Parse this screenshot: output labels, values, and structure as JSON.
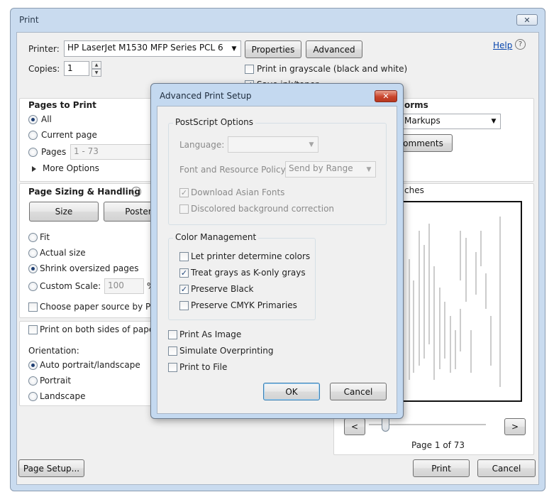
{
  "window": {
    "title": "Print",
    "close_glyph": "✕"
  },
  "printer": {
    "label": "Printer:",
    "selected": "HP LaserJet M1530 MFP Series PCL 6",
    "properties": "Properties",
    "advanced": "Advanced",
    "copies_label": "Copies:",
    "copies_value": "1",
    "grayscale": "Print in grayscale (black and white)",
    "save_ink_partial": "Save ink/toner"
  },
  "help": {
    "label": "Help",
    "icon": "help-circle-icon"
  },
  "pages_to_print": {
    "title": "Pages to Print",
    "all": "All",
    "current_page": "Current page",
    "pages": "Pages",
    "pages_value": "1 - 73",
    "more_options": "More Options"
  },
  "comments_forms": {
    "title_partial": "orms",
    "selected_partial": "Markups",
    "summarize_partial": "omments"
  },
  "page_sizing": {
    "title": "Page Sizing & Handling",
    "size_button": "Size",
    "poster_button": "Poster",
    "fit": "Fit",
    "actual_size": "Actual size",
    "shrink": "Shrink oversized pages",
    "custom_scale": "Custom Scale:",
    "custom_scale_value": "100",
    "custom_scale_unit": "%",
    "paper_source": "Choose paper source by PDF page size"
  },
  "duplex": {
    "both_sides": "Print on both sides of paper",
    "orientation_label": "Orientation:",
    "auto": "Auto portrait/landscape",
    "portrait": "Portrait",
    "landscape": "Landscape"
  },
  "preview": {
    "units_partial": "ches",
    "page_status": "Page 1 of 73",
    "prev": "<",
    "next": ">"
  },
  "footer": {
    "page_setup": "Page Setup...",
    "print": "Print",
    "cancel": "Cancel"
  },
  "advanced_dialog": {
    "title": "Advanced Print Setup",
    "close_glyph": "✕",
    "postscript_title": "PostScript Options",
    "language_label": "Language:",
    "language_value": "",
    "font_policy_label": "Font and Resource Policy:",
    "font_policy_value": "Send by Range",
    "download_asian": "Download Asian Fonts",
    "discolored": "Discolored background correction",
    "color_title": "Color Management",
    "let_printer": "Let printer determine colors",
    "treat_grays": "Treat grays as K-only grays",
    "preserve_black": "Preserve Black",
    "preserve_cmyk": "Preserve CMYK Primaries",
    "print_as_image": "Print As Image",
    "simulate_overprinting": "Simulate Overprinting",
    "print_to_file": "Print to File",
    "ok": "OK",
    "cancel": "Cancel"
  },
  "colors": {
    "accent": "#3c7fb1",
    "title_bar": "#c9dbef",
    "close_red": "#c9452d"
  }
}
